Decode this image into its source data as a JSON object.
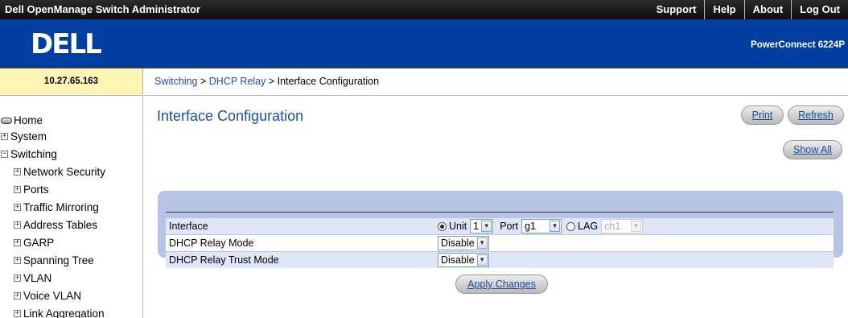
{
  "topbar": {
    "app_title": "Dell OpenManage Switch Administrator",
    "links": [
      "Support",
      "Help",
      "About",
      "Log Out"
    ]
  },
  "header": {
    "logo_text": "DELL",
    "model": "PowerConnect 6224P"
  },
  "ip_address": "10.27.65.163",
  "breadcrumb": {
    "items": [
      "Switching",
      "DHCP Relay",
      "Interface Configuration"
    ],
    "separator": " > "
  },
  "nav": {
    "home": "Home",
    "system": "System",
    "switching": "Switching",
    "children": [
      "Network Security",
      "Ports",
      "Traffic Mirroring",
      "Address Tables",
      "GARP",
      "Spanning Tree",
      "VLAN",
      "Voice VLAN",
      "Link Aggregation"
    ]
  },
  "page": {
    "title": "Interface Configuration",
    "print_label": "Print",
    "refresh_label": "Refresh",
    "show_all_label": "Show All",
    "apply_label": "Apply Changes"
  },
  "form": {
    "interface_label": "Interface",
    "unit_label": "Unit",
    "unit_value": "1",
    "port_label": "Port",
    "port_value": "g1",
    "lag_label": "LAG",
    "lag_value": "ch1",
    "relay_mode_label": "DHCP Relay Mode",
    "relay_mode_value": "Disable",
    "trust_mode_label": "DHCP Relay Trust Mode",
    "trust_mode_value": "Disable",
    "selected_radio": "Unit"
  },
  "colors": {
    "header_blue": "#003fa0",
    "panel_blue": "#b6c4e6",
    "link_blue": "#1f4fa0",
    "ip_bg": "#fff6b5"
  }
}
